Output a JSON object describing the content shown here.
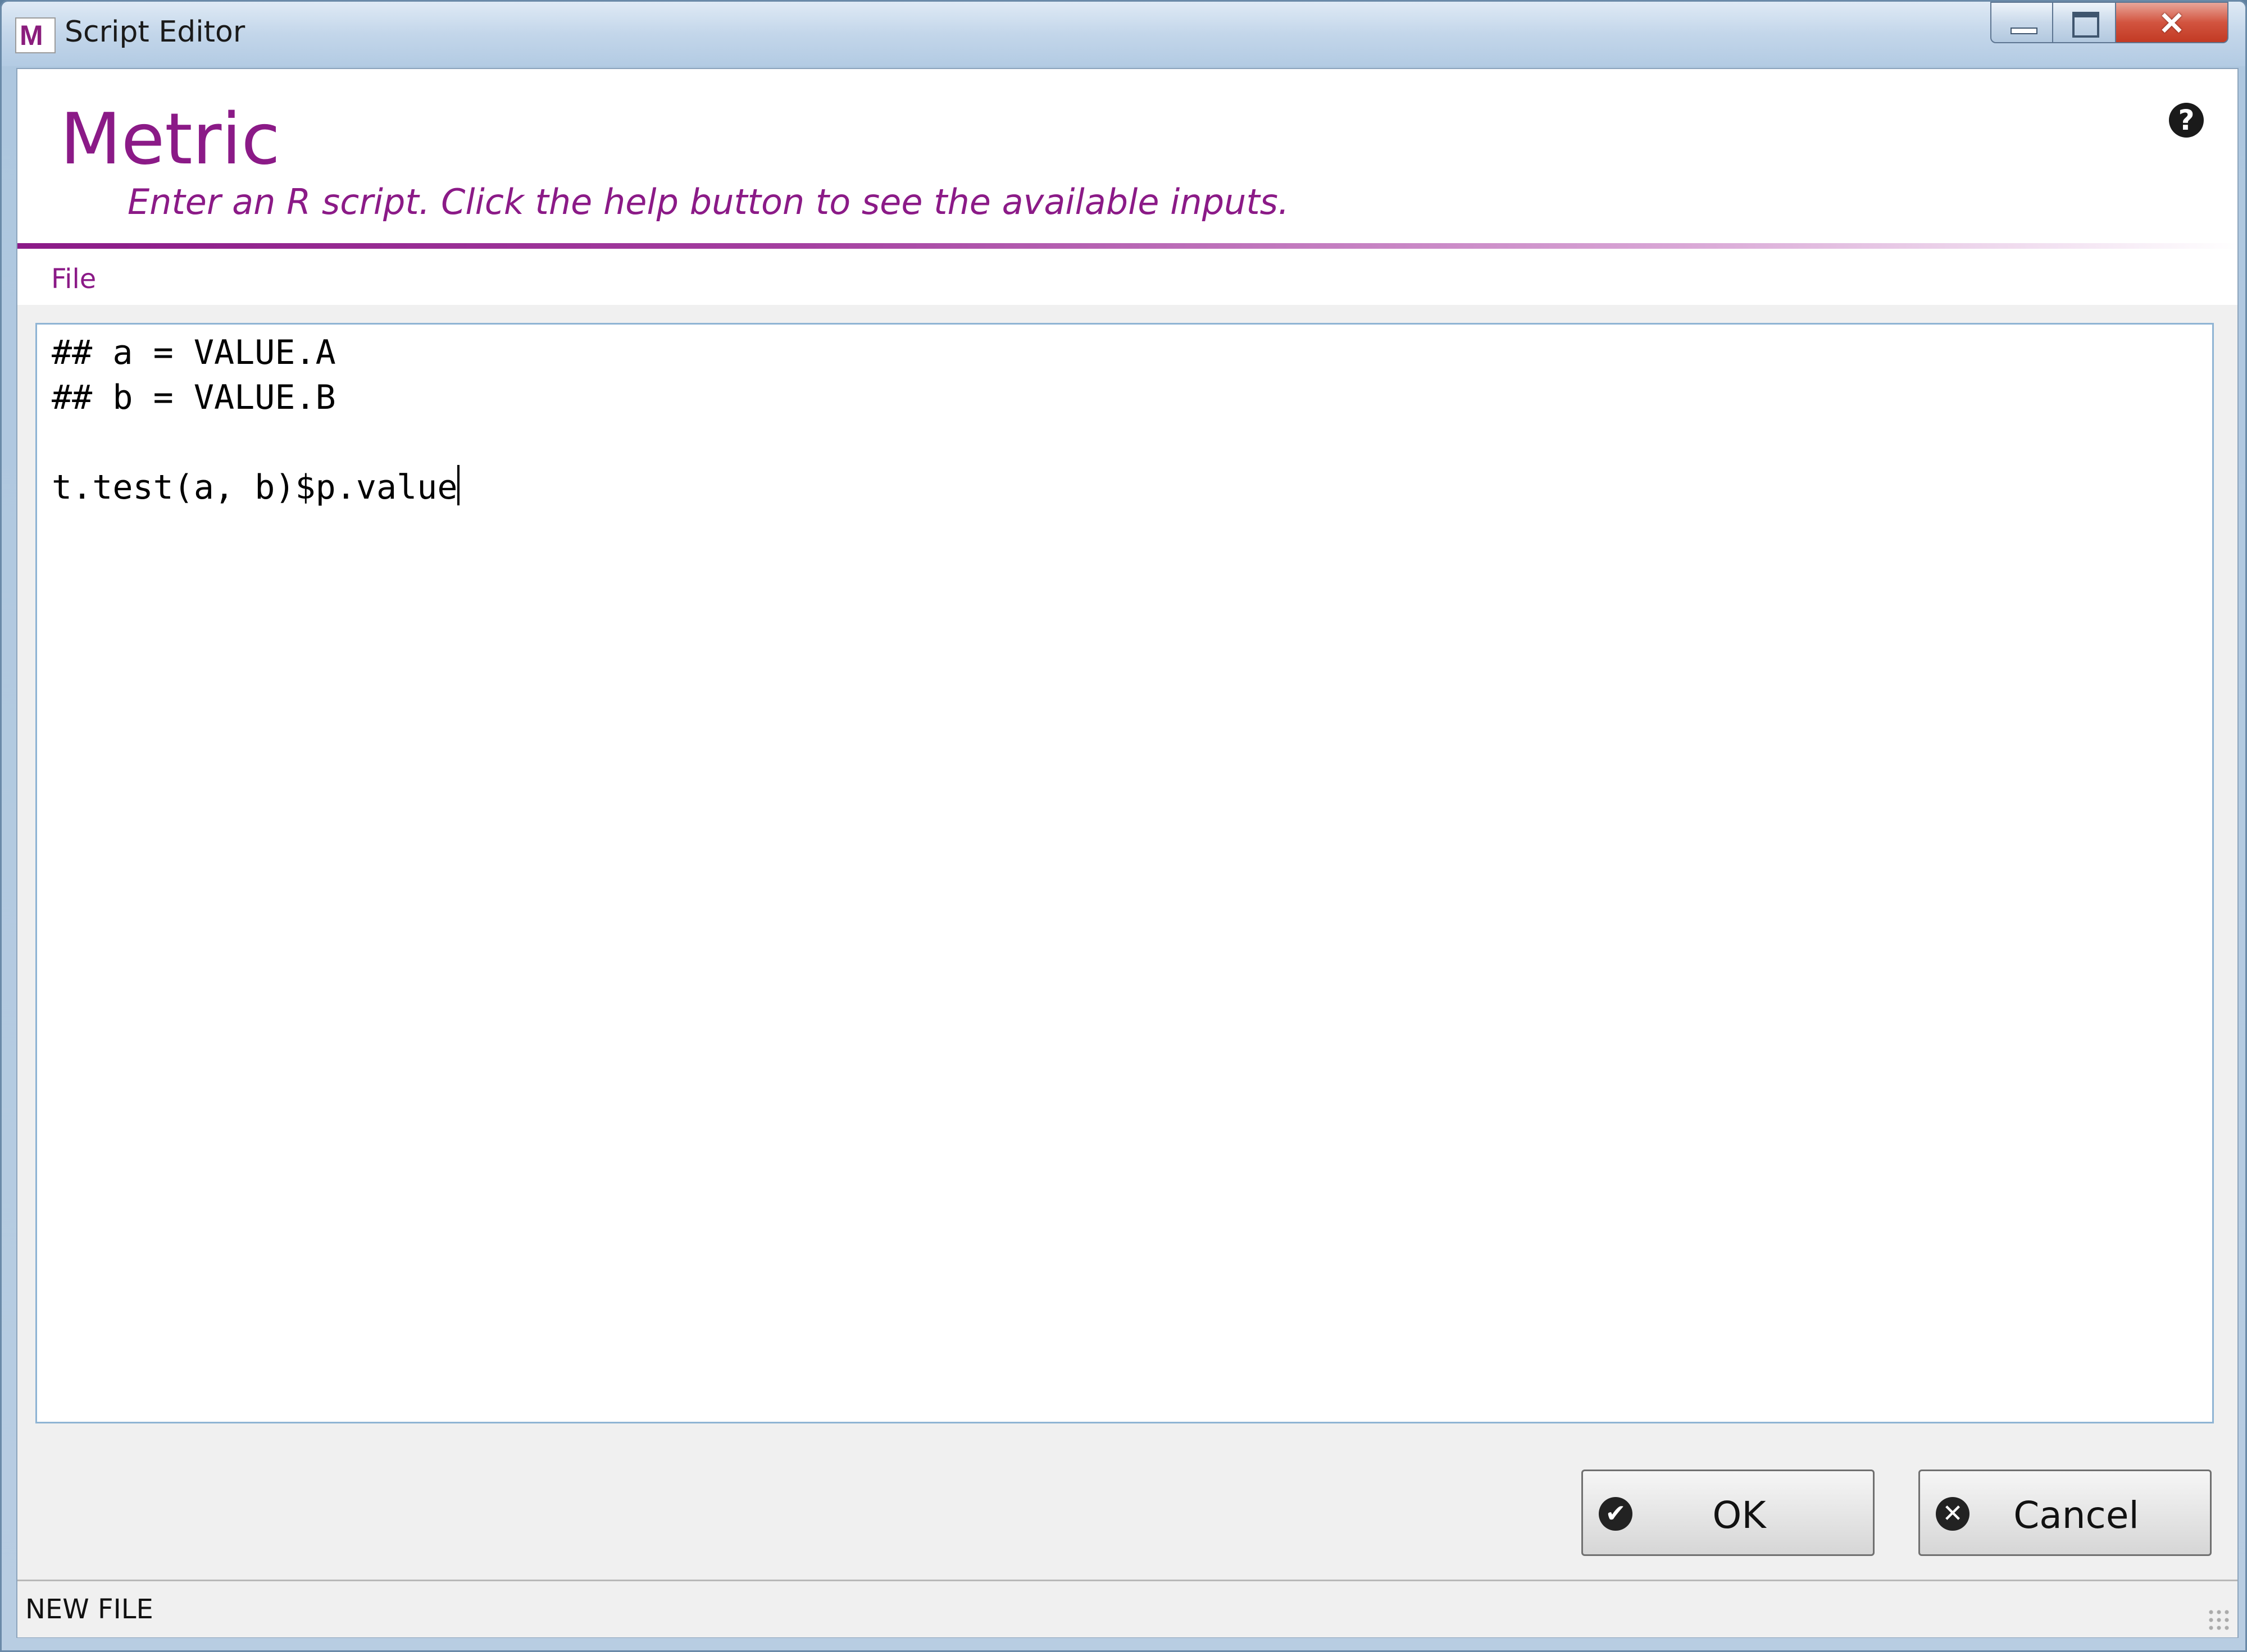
{
  "window": {
    "title": "Script Editor",
    "app_icon_letter": "M",
    "controls": {
      "minimize": "minimize-icon",
      "maximize": "maximize-icon",
      "close": "close-icon"
    }
  },
  "header": {
    "title": "Metric",
    "subtitle": "Enter an R script. Click the help button to see the available inputs.",
    "help_icon": "?",
    "accent_color": "#8b1a87"
  },
  "menu": {
    "items": [
      {
        "label": "File"
      }
    ]
  },
  "editor": {
    "lines": [
      "## a = VALUE.A",
      "## b = VALUE.B",
      "",
      "t.test(a, b)$p.value"
    ]
  },
  "buttons": {
    "ok": {
      "label": "OK",
      "icon": "check-circle-icon",
      "glyph": "✔"
    },
    "cancel": {
      "label": "Cancel",
      "icon": "x-circle-icon",
      "glyph": "✕"
    }
  },
  "status": {
    "text": "NEW FILE"
  }
}
